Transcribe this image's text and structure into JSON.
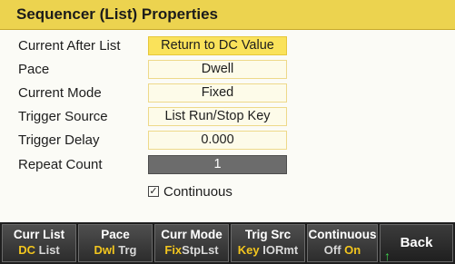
{
  "window": {
    "title": "Sequencer (List) Properties"
  },
  "rows": [
    {
      "label": "Current After List",
      "value": "Return to DC Value"
    },
    {
      "label": "Pace",
      "value": "Dwell"
    },
    {
      "label": "Current Mode",
      "value": "Fixed"
    },
    {
      "label": "Trigger Source",
      "value": "List Run/Stop Key"
    },
    {
      "label": "Trigger Delay",
      "value": "0.000"
    },
    {
      "label": "Repeat Count",
      "value": "1"
    }
  ],
  "continuous": {
    "label": "Continuous",
    "checked": true,
    "mark": "✓"
  },
  "softkeys": [
    {
      "title": "Curr List",
      "options": [
        "DC",
        "List"
      ],
      "active": "DC"
    },
    {
      "title": "Pace",
      "options": [
        "Dwl",
        "Trg"
      ],
      "active": "Dwl"
    },
    {
      "title": "Curr Mode",
      "options": [
        "Fix",
        "Stp",
        "Lst"
      ],
      "active": "Fix"
    },
    {
      "title": "Trig Src",
      "options": [
        "Key",
        "IO",
        "Rmt"
      ],
      "active": "Key"
    },
    {
      "title": "Continuous",
      "options": [
        "Off",
        "On"
      ],
      "active": "On"
    }
  ],
  "back": {
    "label": "Back",
    "arrow": "↑"
  },
  "colors": {
    "accent": "#ecd34f",
    "active_option": "#f2c51e",
    "softkey_bg": "#2c2c2c"
  }
}
